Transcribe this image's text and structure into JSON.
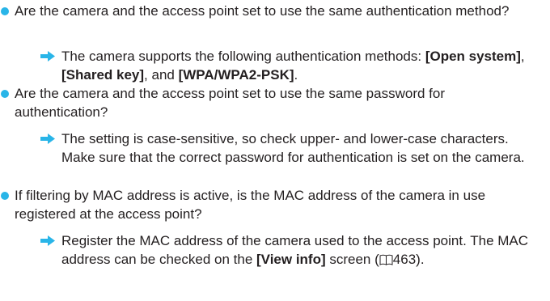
{
  "colors": {
    "bullet": "#29b5e8",
    "arrow": "#29b5e8",
    "text": "#231f20"
  },
  "items": [
    {
      "question": "Are the camera and the access point set to use the same authentication method?",
      "answer": {
        "prefix": "The camera supports the following authentication methods: ",
        "b1": "[Open system]",
        "sep1": ", ",
        "b2": "[Shared key]",
        "sep2": ", and ",
        "b3": "[WPA/WPA2-PSK]",
        "end": "."
      }
    },
    {
      "question": "Are the camera and the access point set to use the same password for authentication?",
      "answer": {
        "text": "The setting is case-sensitive, so check upper- and lower-case characters. Make sure that the correct password for authentication is set on the camera."
      }
    },
    {
      "question": "If filtering by MAC address is active, is the MAC address of the camera in use registered at the access point?",
      "answer": {
        "prefix": "Register the MAC address of the camera used to the access point. The MAC address can be checked on the ",
        "bold": "[View info]",
        "middle": " screen (",
        "ref_icon": "book-icon",
        "page_ref": "463",
        "end": ")."
      }
    }
  ]
}
